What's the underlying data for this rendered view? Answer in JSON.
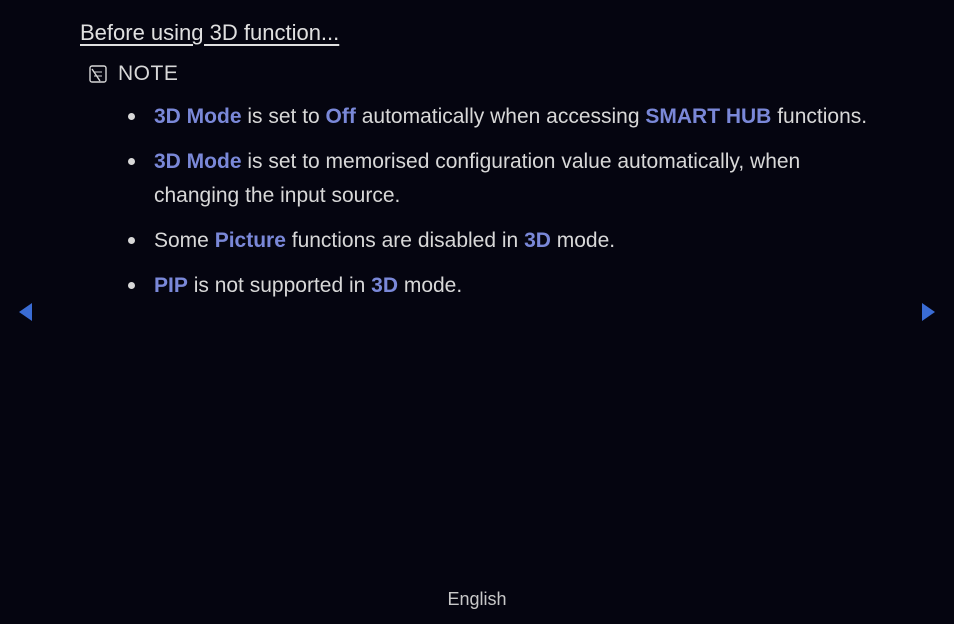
{
  "heading": "Before using 3D function...",
  "noteLabel": "NOTE",
  "bullets": [
    {
      "parts": [
        {
          "t": "hl",
          "v": "3D Mode"
        },
        {
          "t": "n",
          "v": " is set to "
        },
        {
          "t": "hl",
          "v": "Off"
        },
        {
          "t": "n",
          "v": " automatically when accessing "
        },
        {
          "t": "hl",
          "v": "SMART HUB"
        },
        {
          "t": "n",
          "v": " functions."
        }
      ]
    },
    {
      "parts": [
        {
          "t": "hl",
          "v": "3D Mode"
        },
        {
          "t": "n",
          "v": " is set to memorised configuration value automatically, when changing the input source."
        }
      ]
    },
    {
      "parts": [
        {
          "t": "n",
          "v": "Some "
        },
        {
          "t": "hl",
          "v": "Picture"
        },
        {
          "t": "n",
          "v": " functions are disabled in "
        },
        {
          "t": "hl",
          "v": "3D"
        },
        {
          "t": "n",
          "v": " mode."
        }
      ]
    },
    {
      "parts": [
        {
          "t": "hl",
          "v": "PIP"
        },
        {
          "t": "n",
          "v": " is not supported in "
        },
        {
          "t": "hl",
          "v": "3D"
        },
        {
          "t": "n",
          "v": " mode."
        }
      ]
    }
  ],
  "footerLanguage": "English",
  "colors": {
    "highlight": "#7a88d8",
    "navArrow": "#3a6cd4",
    "text": "#d8d8d8",
    "bg": "#050510"
  }
}
